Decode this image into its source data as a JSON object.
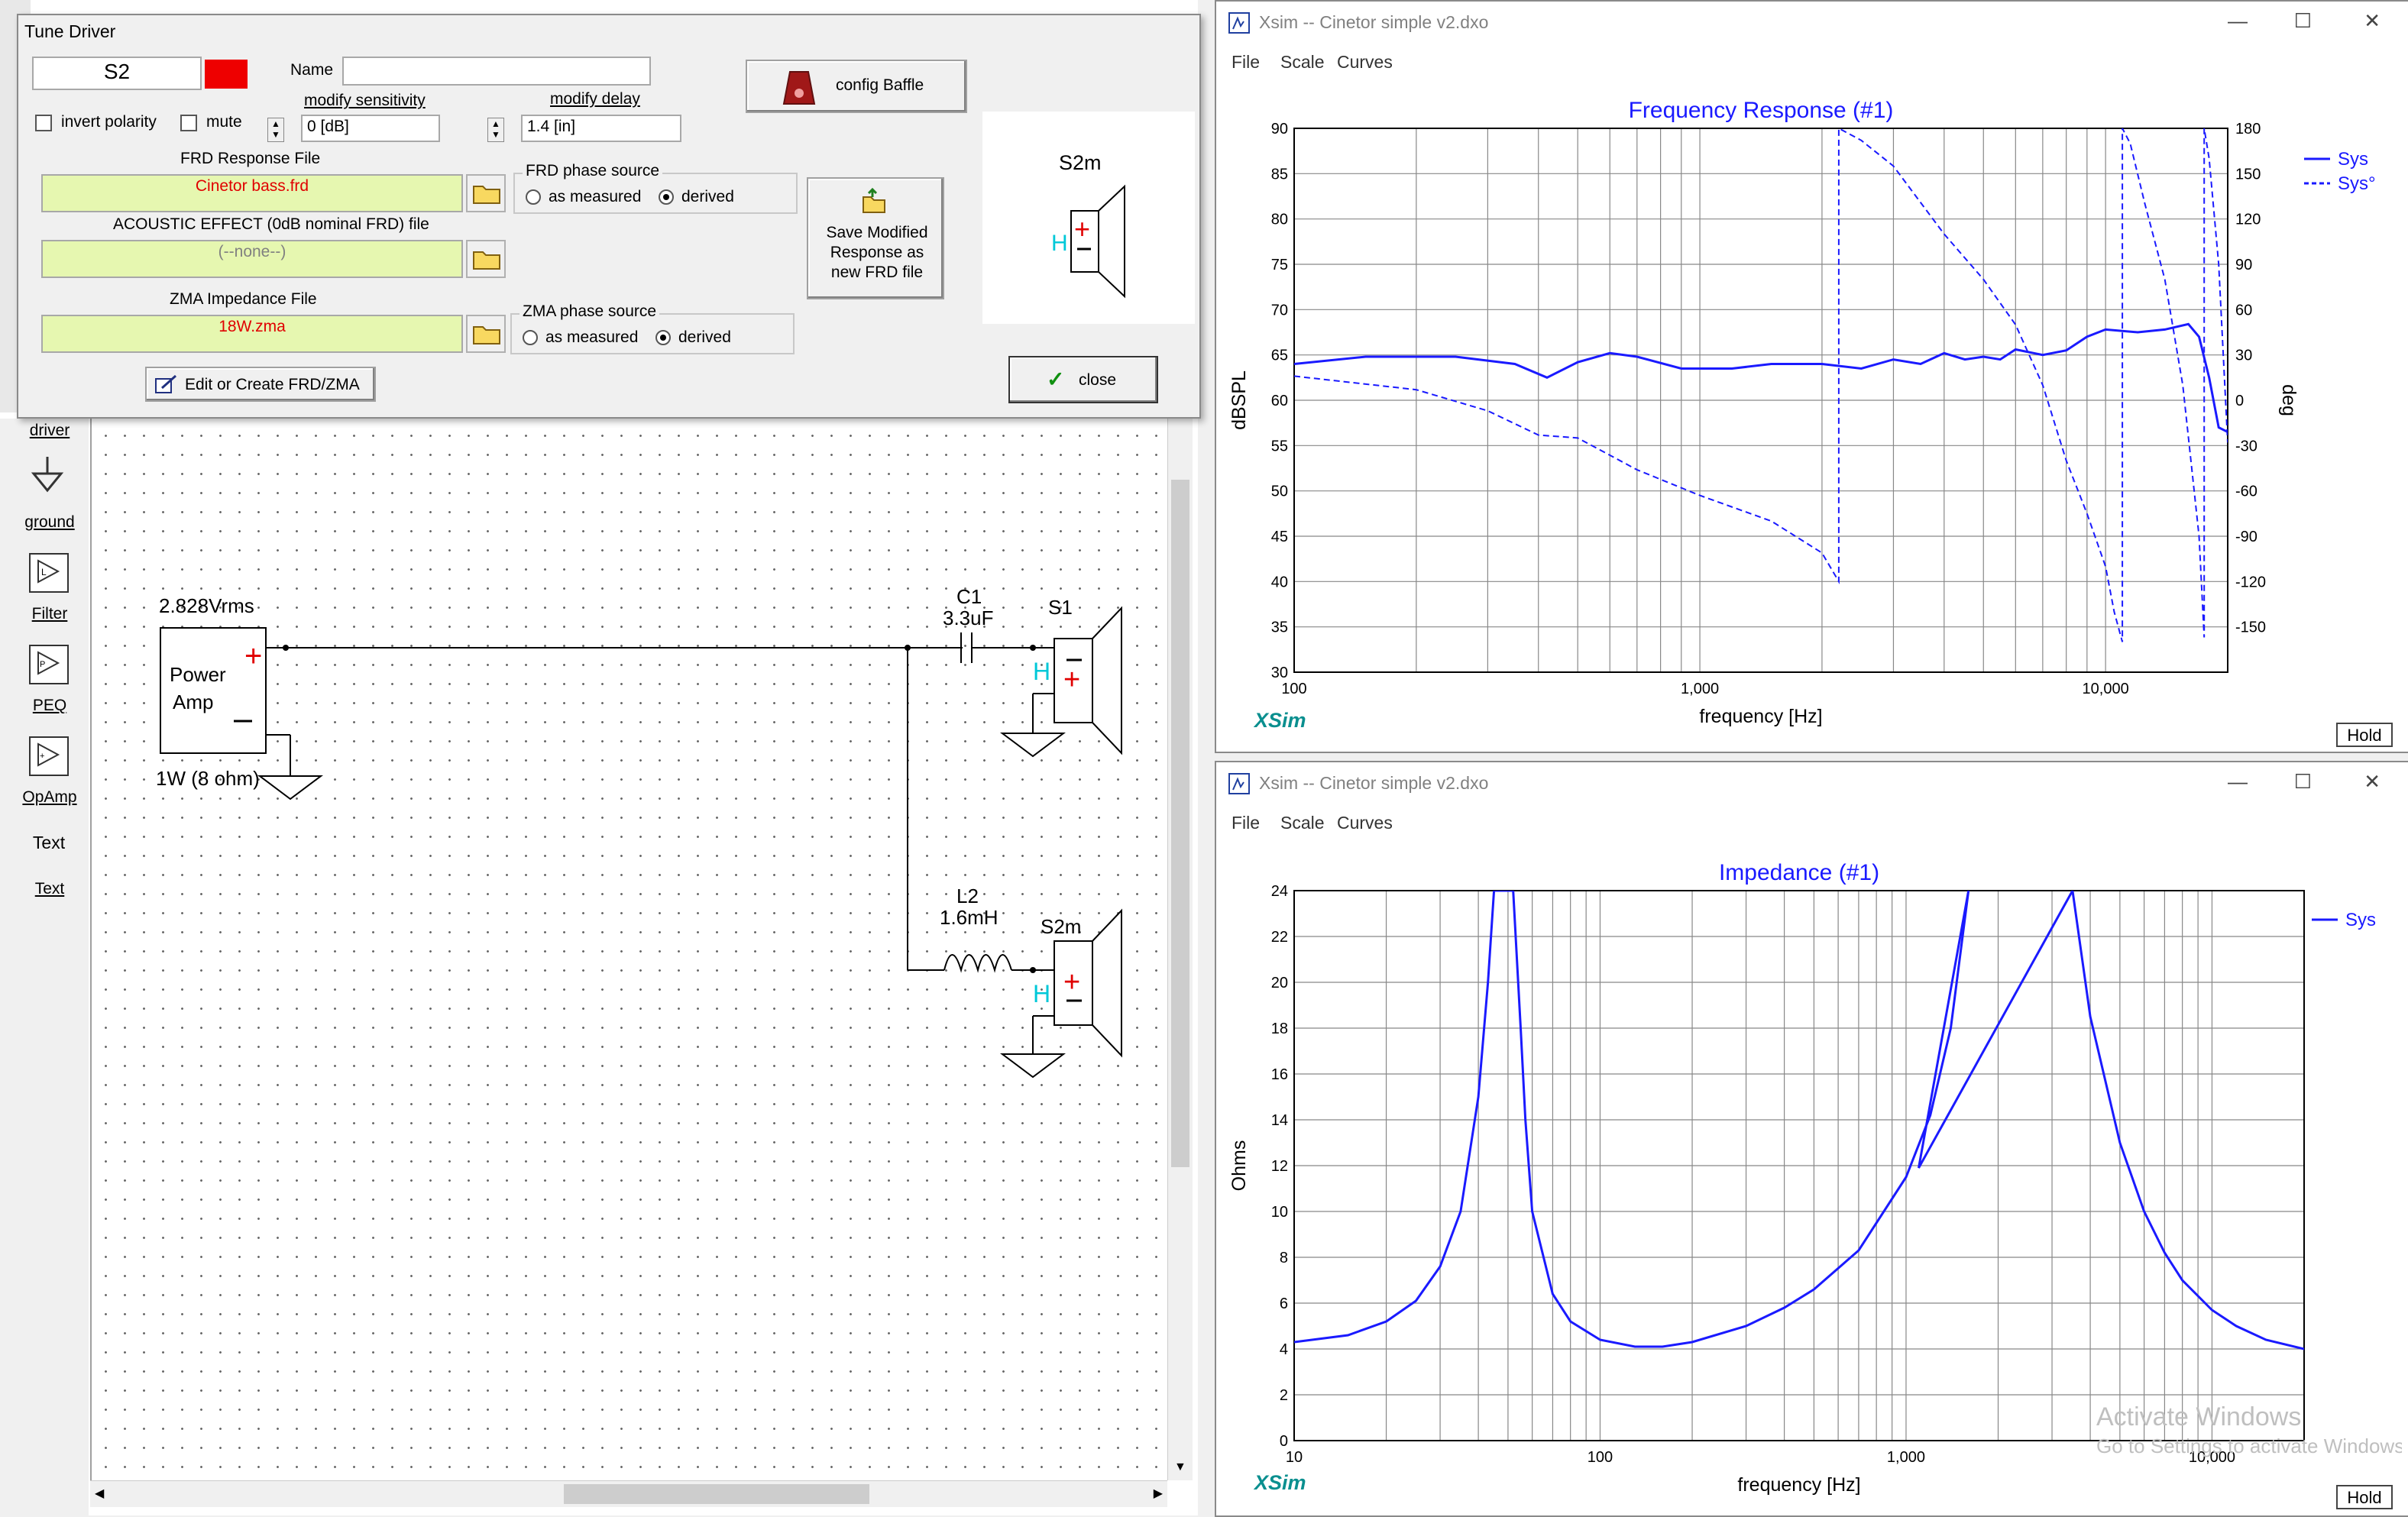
{
  "tune_driver": {
    "title": "Tune Driver",
    "driver_name": "S2",
    "driver_color": "#ee0000",
    "name_label": "Name",
    "name_value": "",
    "invert_polarity_label": "invert polarity",
    "mute_label": "mute",
    "modify_sensitivity_label": "modify sensitivity",
    "modify_sensitivity_value": "0 [dB]",
    "modify_delay_label": "modify delay",
    "modify_delay_value": "1.4 [in]",
    "config_baffle_label": "config Baffle",
    "frd_file_label": "FRD Response File",
    "frd_file_value": "Cinetor bass.frd",
    "frd_phase_source_label": "FRD phase source",
    "as_measured_label": "as measured",
    "derived_label": "derived",
    "acoustic_effect_label": "ACOUSTIC EFFECT (0dB nominal FRD) file",
    "acoustic_effect_value": "(--none--)",
    "save_modified_label": "Save Modified Response as new FRD file",
    "zma_file_label": "ZMA Impedance File",
    "zma_file_value": "18W.zma",
    "zma_phase_source_label": "ZMA phase source",
    "edit_create_label": "Edit or Create FRD/ZMA",
    "close_label": "close",
    "preview_name": "S2m"
  },
  "palette": {
    "items": [
      "driver",
      "ground",
      "Filter",
      "PEQ",
      "OpAmp",
      "Text"
    ],
    "text_icon": "Text"
  },
  "schematic": {
    "source_voltage": "2.828Vrms",
    "amp_label_1": "Power",
    "amp_label_2": "Amp",
    "amp_power": "1W (8 ohm)",
    "c1_name": "C1",
    "c1_value": "3.3uF",
    "s1_name": "S1",
    "l2_name": "L2",
    "l2_value": "1.6mH",
    "s2m_name": "S2m"
  },
  "freq_window": {
    "title": "Xsim -- Cinetor simple v2.dxo",
    "menu": [
      "File",
      "Scale",
      "Curves"
    ],
    "hold_label": "Hold",
    "brand": "XSim"
  },
  "imp_window": {
    "title": "Xsim -- Cinetor simple v2.dxo",
    "menu": [
      "File",
      "Scale",
      "Curves"
    ],
    "hold_label": "Hold",
    "brand": "XSim"
  },
  "watermark": {
    "line1": "Activate Windows",
    "line2": "Go to Settings to activate Windows."
  },
  "chart_data": [
    {
      "type": "line",
      "title": "Frequency Response (#1)",
      "xlabel": "frequency [Hz]",
      "ylabel": "dBSPL",
      "y2label": "deg",
      "xscale": "log",
      "xlim": [
        100,
        20000
      ],
      "ylim": [
        30,
        90
      ],
      "y2lim": [
        -180,
        180
      ],
      "xticks": [
        "100",
        "1,000",
        "10,000"
      ],
      "yticks": [
        30,
        35,
        40,
        45,
        50,
        55,
        60,
        65,
        70,
        75,
        80,
        85,
        90
      ],
      "y2ticks": [
        -150,
        -120,
        -90,
        -60,
        -30,
        0,
        30,
        60,
        90,
        120,
        150,
        180
      ],
      "legend": "top-right",
      "series": [
        {
          "name": "Sys",
          "axis": "left",
          "style": "solid",
          "color": "#1a1aff",
          "x": [
            100,
            150,
            250,
            350,
            420,
            500,
            600,
            700,
            900,
            1200,
            1500,
            2000,
            2500,
            3000,
            3500,
            4000,
            4500,
            5000,
            5500,
            6000,
            7000,
            8000,
            9000,
            10000,
            12000,
            14000,
            16000,
            17000,
            18000,
            19000,
            20000
          ],
          "y": [
            64.0,
            64.8,
            64.8,
            64.0,
            62.5,
            64.2,
            65.2,
            64.8,
            63.5,
            63.5,
            64.0,
            64.0,
            63.5,
            64.5,
            64.0,
            65.2,
            64.5,
            64.8,
            64.5,
            65.6,
            65.0,
            65.5,
            67.0,
            67.8,
            67.5,
            67.8,
            68.4,
            67.0,
            62.5,
            57.0,
            56.5
          ]
        },
        {
          "name": "Sys°",
          "axis": "right",
          "style": "dashed",
          "color": "#1a1aff",
          "x": [
            100,
            200,
            300,
            400,
            500,
            700,
            1000,
            1500,
            2000,
            2200,
            2200,
            2500,
            3000,
            4000,
            5000,
            6000,
            7000,
            8000,
            9000,
            10000,
            10500,
            11000,
            11000,
            11500,
            12500,
            14000,
            15500,
            17000,
            17500,
            17500,
            18000,
            19000,
            20000
          ],
          "y": [
            16,
            7,
            -7,
            -23,
            -25,
            -46,
            -63,
            -80,
            -101,
            -120,
            180,
            172,
            155,
            110,
            80,
            50,
            10,
            -40,
            -75,
            -110,
            -140,
            -160,
            180,
            170,
            130,
            80,
            10,
            -90,
            -157,
            180,
            160,
            90,
            -28
          ]
        }
      ]
    },
    {
      "type": "line",
      "title": "Impedance (#1)",
      "xlabel": "frequency [Hz]",
      "ylabel": "Ohms",
      "xscale": "log",
      "xlim": [
        10,
        20000
      ],
      "ylim": [
        0,
        24
      ],
      "xticks": [
        "10",
        "100",
        "1,000",
        "10,000"
      ],
      "yticks": [
        0,
        2,
        4,
        6,
        8,
        10,
        12,
        14,
        16,
        18,
        20,
        22,
        24
      ],
      "legend": "top-right",
      "series": [
        {
          "name": "Sys",
          "color": "#1a1aff",
          "x": [
            10,
            15,
            20,
            25,
            30,
            35,
            40,
            43,
            45,
            52,
            55,
            57,
            60,
            70,
            80,
            100,
            130,
            160,
            200,
            300,
            400,
            500,
            700,
            1000,
            1200,
            1400,
            1600,
            1100,
            3500,
            4000,
            5000,
            6000,
            7000,
            8000,
            10000,
            12000,
            15000,
            20000
          ],
          "y": [
            4.3,
            4.6,
            5.2,
            6.1,
            7.6,
            10.0,
            15.0,
            20.0,
            24.0,
            24.0,
            18.0,
            14.0,
            10.0,
            6.4,
            5.2,
            4.4,
            4.1,
            4.1,
            4.3,
            5.0,
            5.8,
            6.6,
            8.3,
            11.5,
            14.2,
            18.0,
            24.0,
            11.9,
            24.0,
            18.5,
            13.0,
            10.0,
            8.2,
            7.0,
            5.7,
            5.0,
            4.4,
            4.0
          ]
        }
      ]
    }
  ]
}
